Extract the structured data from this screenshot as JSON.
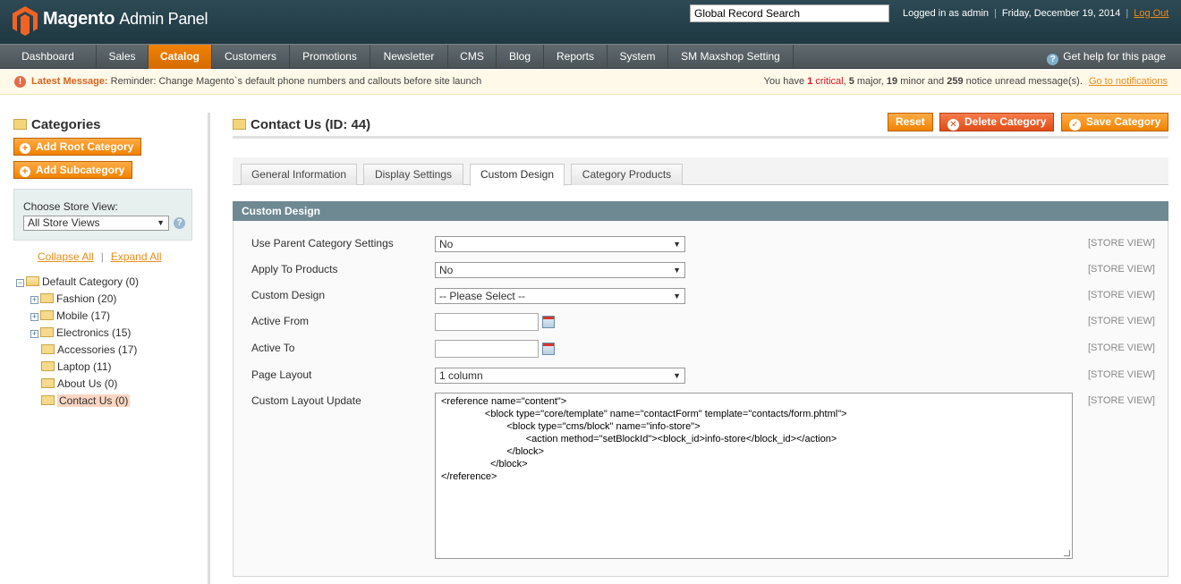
{
  "header": {
    "logo_main": "Magento",
    "logo_sub": "Admin Panel",
    "search_value": "Global Record Search",
    "logged_in": "Logged in as admin",
    "date": "Friday, December 19, 2014",
    "logout": "Log Out"
  },
  "nav": {
    "items": [
      "Dashboard",
      "Sales",
      "Catalog",
      "Customers",
      "Promotions",
      "Newsletter",
      "CMS",
      "Blog",
      "Reports",
      "System",
      "SM Maxshop Setting"
    ],
    "active": "Catalog",
    "help": "Get help for this page"
  },
  "message": {
    "label": "Latest Message:",
    "text": "Reminder: Change Magento`s default phone numbers and callouts before site launch",
    "right_prefix": "You have",
    "critical_count": "1",
    "critical": "critical",
    "major_count": "5",
    "major": "major,",
    "minor_count": "19",
    "minor": "minor and",
    "notice_count": "259",
    "notice": "notice unread message(s).",
    "link": "Go to notifications"
  },
  "sidebar": {
    "title": "Categories",
    "add_root": "Add Root Category",
    "add_sub": "Add Subcategory",
    "store_label": "Choose Store View:",
    "store_value": "All Store Views",
    "collapse": "Collapse All",
    "sep": "|",
    "expand": "Expand All",
    "tree": [
      {
        "label": "Default Category (0)",
        "level": 0,
        "toggle": "−"
      },
      {
        "label": "Fashion (20)",
        "level": 1,
        "toggle": "+"
      },
      {
        "label": "Mobile (17)",
        "level": 1,
        "toggle": "+"
      },
      {
        "label": "Electronics (15)",
        "level": 1,
        "toggle": "+"
      },
      {
        "label": "Accessories (17)",
        "level": 1,
        "toggle": ""
      },
      {
        "label": "Laptop (11)",
        "level": 1,
        "toggle": ""
      },
      {
        "label": "About Us (0)",
        "level": 1,
        "toggle": ""
      },
      {
        "label": "Contact Us (0)",
        "level": 1,
        "toggle": "",
        "selected": true
      }
    ]
  },
  "main": {
    "title": "Contact Us (ID: 44)",
    "reset": "Reset",
    "delete": "Delete Category",
    "save": "Save Category",
    "tabs": [
      "General Information",
      "Display Settings",
      "Custom Design",
      "Category Products"
    ],
    "active_tab": "Custom Design",
    "section_title": "Custom Design",
    "scope": "[STORE VIEW]",
    "fields": {
      "use_parent_label": "Use Parent Category Settings",
      "use_parent_value": "No",
      "apply_label": "Apply To Products",
      "apply_value": "No",
      "design_label": "Custom Design",
      "design_value": "-- Please Select --",
      "from_label": "Active From",
      "from_value": "",
      "to_label": "Active To",
      "to_value": "",
      "layout_label": "Page Layout",
      "layout_value": "1 column",
      "update_label": "Custom Layout Update",
      "update_value": "<reference name=\"content\">\n                <block type=\"core/template\" name=\"contactForm\" template=\"contacts/form.phtml\">\n                        <block type=\"cms/block\" name=\"info-store\">\n                               <action method=\"setBlockId\"><block_id>info-store</block_id></action>\n                        </block>\n                  </block>\n</reference>"
    }
  }
}
